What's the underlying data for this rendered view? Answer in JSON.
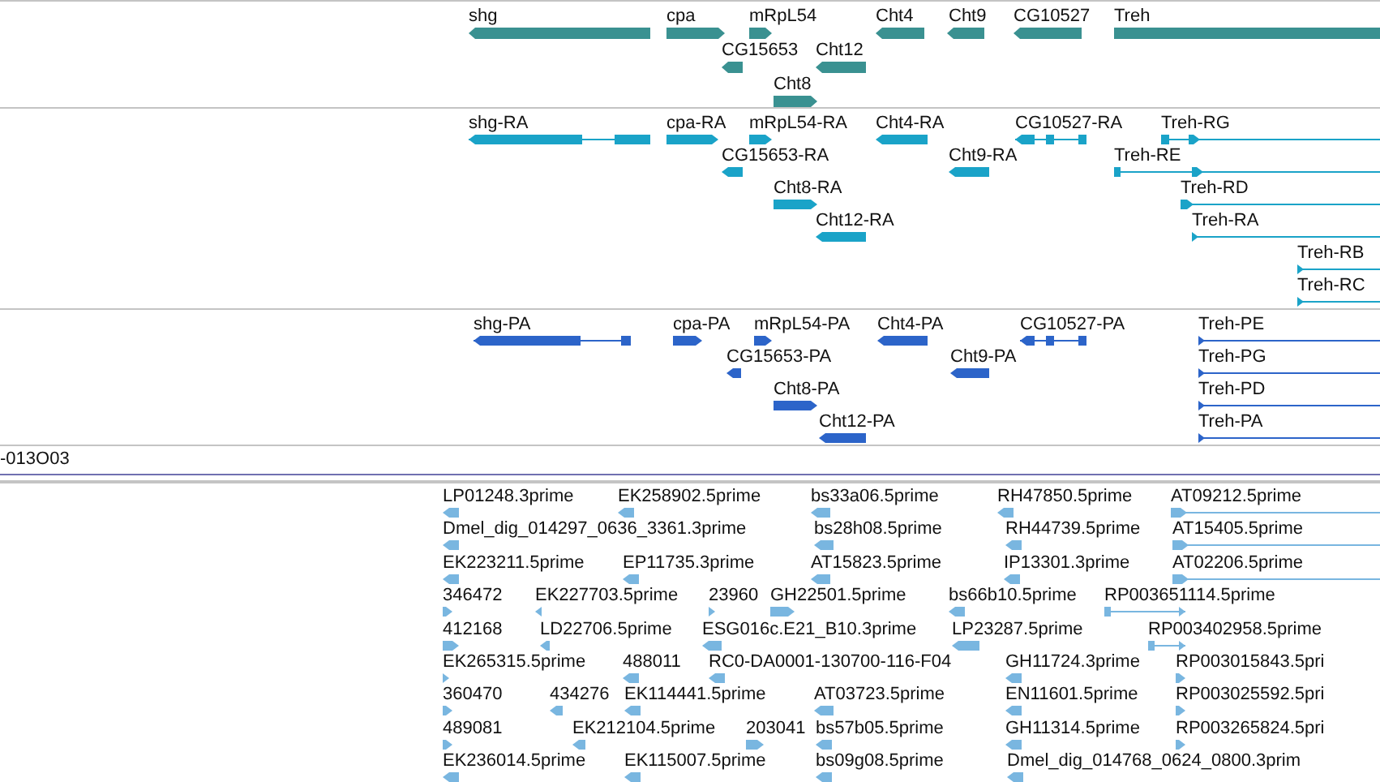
{
  "tracks": [
    {
      "kind": "gene",
      "features": [
        {
          "label": "shg",
          "reverse": true
        },
        {
          "label": "cpa",
          "reverse": false
        },
        {
          "label": "mRpL54",
          "reverse": false
        },
        {
          "label": "Cht4",
          "reverse": true
        },
        {
          "label": "Cht9",
          "reverse": true
        },
        {
          "label": "CG10527",
          "reverse": true
        },
        {
          "label": "Treh"
        },
        {
          "label": "CG15653",
          "reverse": true
        },
        {
          "label": "Cht12",
          "reverse": true
        },
        {
          "label": "Cht8",
          "reverse": false
        }
      ]
    },
    {
      "kind": "transcript",
      "features": [
        {
          "label": "shg-RA",
          "reverse": true
        },
        {
          "label": "cpa-RA",
          "reverse": false
        },
        {
          "label": "mRpL54-RA",
          "reverse": false
        },
        {
          "label": "Cht4-RA",
          "reverse": true
        },
        {
          "label": "CG10527-RA",
          "reverse": true
        },
        {
          "label": "Treh-RG",
          "reverse": false
        },
        {
          "label": "CG15653-RA",
          "reverse": true
        },
        {
          "label": "Cht9-RA",
          "reverse": true
        },
        {
          "label": "Treh-RE",
          "reverse": false
        },
        {
          "label": "Cht8-RA",
          "reverse": false
        },
        {
          "label": "Treh-RD",
          "reverse": false
        },
        {
          "label": "Cht12-RA",
          "reverse": true
        },
        {
          "label": "Treh-RA",
          "reverse": false
        },
        {
          "label": "Treh-RB",
          "reverse": false
        },
        {
          "label": "Treh-RC",
          "reverse": false
        }
      ]
    },
    {
      "kind": "protein",
      "features": [
        {
          "label": "shg-PA",
          "reverse": true
        },
        {
          "label": "cpa-PA",
          "reverse": false
        },
        {
          "label": "mRpL54-PA",
          "reverse": false
        },
        {
          "label": "Cht4-PA",
          "reverse": true
        },
        {
          "label": "CG10527-PA",
          "reverse": true
        },
        {
          "label": "Treh-PE",
          "reverse": false
        },
        {
          "label": "CG15653-PA",
          "reverse": true
        },
        {
          "label": "Cht9-PA",
          "reverse": true
        },
        {
          "label": "Treh-PG",
          "reverse": false
        },
        {
          "label": "Cht8-PA",
          "reverse": false
        },
        {
          "label": "Treh-PD",
          "reverse": false
        },
        {
          "label": "Cht12-PA",
          "reverse": true
        },
        {
          "label": "Treh-PA",
          "reverse": false
        }
      ]
    },
    {
      "kind": "label",
      "features": [
        {
          "label": "-013O03"
        }
      ]
    },
    {
      "kind": "est",
      "features": [
        {
          "label": "LP01248.3prime",
          "reverse": true
        },
        {
          "label": "EK258902.5prime",
          "reverse": true
        },
        {
          "label": "bs33a06.5prime",
          "reverse": true
        },
        {
          "label": "RH47850.5prime",
          "reverse": true
        },
        {
          "label": "AT09212.5prime",
          "reverse": false
        },
        {
          "label": "Dmel_dig_014297_0636_3361.3prime",
          "reverse": true
        },
        {
          "label": "bs28h08.5prime",
          "reverse": true
        },
        {
          "label": "RH44739.5prime",
          "reverse": true
        },
        {
          "label": "AT15405.5prime",
          "reverse": false
        },
        {
          "label": "EK223211.5prime",
          "reverse": true
        },
        {
          "label": "EP11735.3prime",
          "reverse": true
        },
        {
          "label": "AT15823.5prime",
          "reverse": true
        },
        {
          "label": "IP13301.3prime",
          "reverse": true
        },
        {
          "label": "AT02206.5prime",
          "reverse": false
        },
        {
          "label": "346472",
          "reverse": false
        },
        {
          "label": "EK227703.5prime",
          "reverse": true
        },
        {
          "label": "23960",
          "reverse": false
        },
        {
          "label": "GH22501.5prime",
          "reverse": false
        },
        {
          "label": "bs66b10.5prime",
          "reverse": true
        },
        {
          "label": "RP003651114.5prime",
          "reverse": false
        },
        {
          "label": "412168",
          "reverse": false
        },
        {
          "label": "LD22706.5prime",
          "reverse": true
        },
        {
          "label": "ESG016c.E21_B10.3prime",
          "reverse": true
        },
        {
          "label": "LP23287.5prime",
          "reverse": true
        },
        {
          "label": "RP003402958.5prime",
          "reverse": false
        },
        {
          "label": "EK265315.5prime",
          "reverse": false
        },
        {
          "label": "488011",
          "reverse": true
        },
        {
          "label": "RC0-DA0001-130700-116-F04",
          "reverse": true
        },
        {
          "label": "GH11724.3prime",
          "reverse": true
        },
        {
          "label": "RP003015843.5pri",
          "reverse": false
        },
        {
          "label": "360470",
          "reverse": false
        },
        {
          "label": "434276",
          "reverse": true
        },
        {
          "label": "EK114441.5prime",
          "reverse": true
        },
        {
          "label": "AT03723.5prime",
          "reverse": true
        },
        {
          "label": "EN11601.5prime",
          "reverse": true
        },
        {
          "label": "RP003025592.5pri",
          "reverse": false
        },
        {
          "label": "489081",
          "reverse": false
        },
        {
          "label": "EK212104.5prime",
          "reverse": true
        },
        {
          "label": "203041",
          "reverse": false
        },
        {
          "label": "bs57b05.5prime",
          "reverse": true
        },
        {
          "label": "GH11314.5prime",
          "reverse": true
        },
        {
          "label": "RP003265824.5pri",
          "reverse": false
        },
        {
          "label": "EK236014.5prime",
          "reverse": true
        },
        {
          "label": "EK115007.5prime",
          "reverse": true
        },
        {
          "label": "bs09g08.5prime",
          "reverse": true
        },
        {
          "label": "Dmel_dig_014768_0624_0800.3prim",
          "reverse": true
        }
      ]
    }
  ]
}
